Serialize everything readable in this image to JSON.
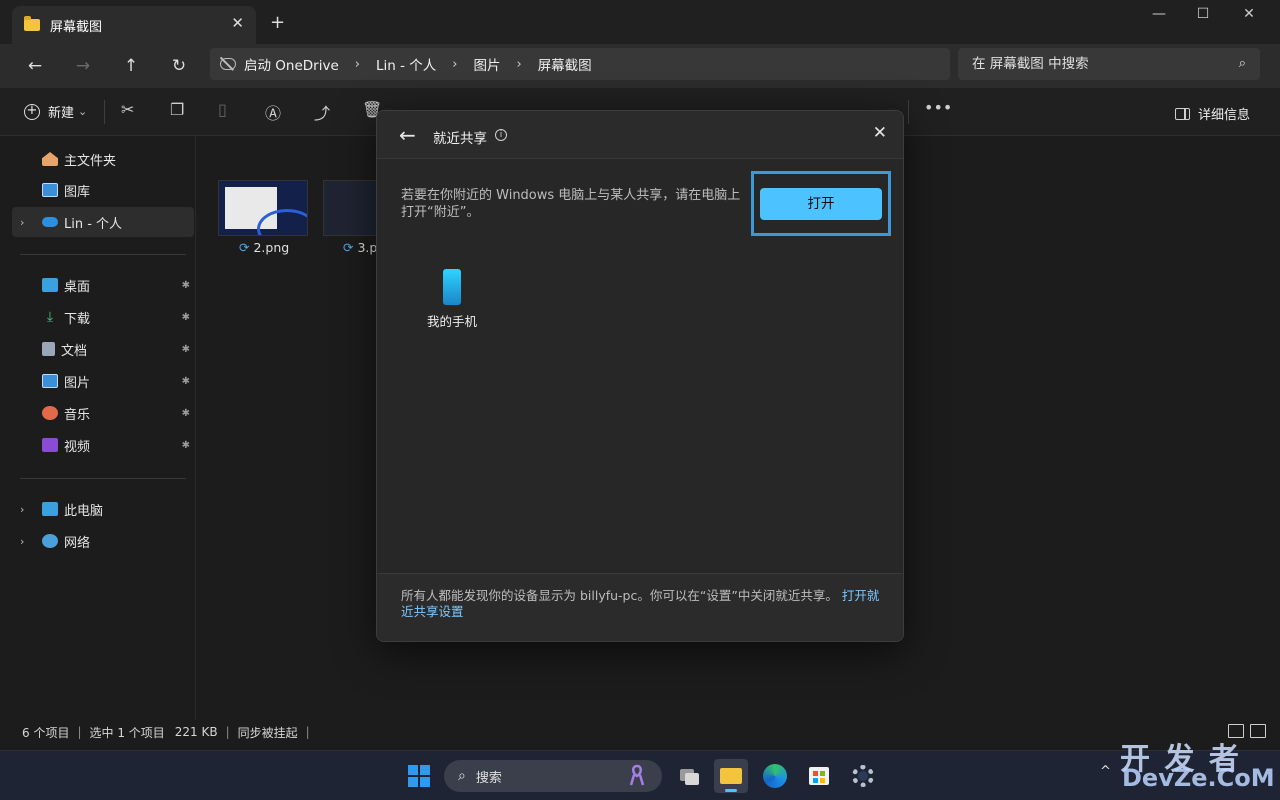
{
  "tab": {
    "title": "屏幕截图",
    "close": "✕",
    "new": "+"
  },
  "window": {
    "minimize": "—",
    "maximize": "☐",
    "close": "✕"
  },
  "nav": {
    "back": "←",
    "forward": "→",
    "up": "↑",
    "refresh": "↻"
  },
  "address": {
    "crumbs": [
      "启动 OneDrive",
      "Lin - 个人",
      "图片",
      "屏幕截图"
    ],
    "sep": "›"
  },
  "search": {
    "placeholder": "在 屏幕截图 中搜索",
    "icon": "⌕"
  },
  "toolbar": {
    "new_label": "新建",
    "new_chev": "⌄",
    "details_label": "详细信息",
    "more": "•••"
  },
  "sidebar": {
    "items": [
      {
        "label": "主文件夹",
        "icon": "home-icon"
      },
      {
        "label": "图库",
        "icon": "gallery-icon"
      },
      {
        "label": "Lin - 个人",
        "icon": "onedrive-icon",
        "selected": true
      },
      {
        "label": "桌面",
        "icon": "desktop-icon",
        "pinned": true
      },
      {
        "label": "下载",
        "icon": "download-icon",
        "pinned": true
      },
      {
        "label": "文档",
        "icon": "documents-icon",
        "pinned": true
      },
      {
        "label": "图片",
        "icon": "pictures-icon",
        "pinned": true
      },
      {
        "label": "音乐",
        "icon": "music-icon",
        "pinned": true
      },
      {
        "label": "视频",
        "icon": "videos-icon",
        "pinned": true
      },
      {
        "label": "此电脑",
        "icon": "pc-icon"
      },
      {
        "label": "网络",
        "icon": "network-icon"
      }
    ],
    "chevron": "›",
    "pin": "📌"
  },
  "files": [
    {
      "name": "2.png"
    },
    {
      "name": "3.p"
    }
  ],
  "status": {
    "count": "6 个项目",
    "selected": "选中 1 个项目",
    "size": "221 KB",
    "sync": "同步被挂起",
    "bar": "|"
  },
  "dialog": {
    "title": "就近共享",
    "info": "i",
    "back": "←",
    "close": "✕",
    "message": "若要在你附近的 Windows 电脑上与某人共享，请在电脑上打开“附近”。",
    "open_button": "打开",
    "device_name": "我的手机",
    "footer_text": "所有人都能发现你的设备显示为 billyfu-pc。你可以在“设置”中关闭就近共享。",
    "footer_link": "打开就近共享设置"
  },
  "taskbar": {
    "search_label": "搜索",
    "search_icon": "⌕",
    "tray_up": "^"
  },
  "watermark": {
    "line1": "开 发 者",
    "line2": "DevZe.CoM"
  },
  "colors": {
    "accent": "#4cc2ff",
    "highlight_box": "#3d98d8",
    "folder": "#f3c43c",
    "link": "#7cc8ff"
  }
}
